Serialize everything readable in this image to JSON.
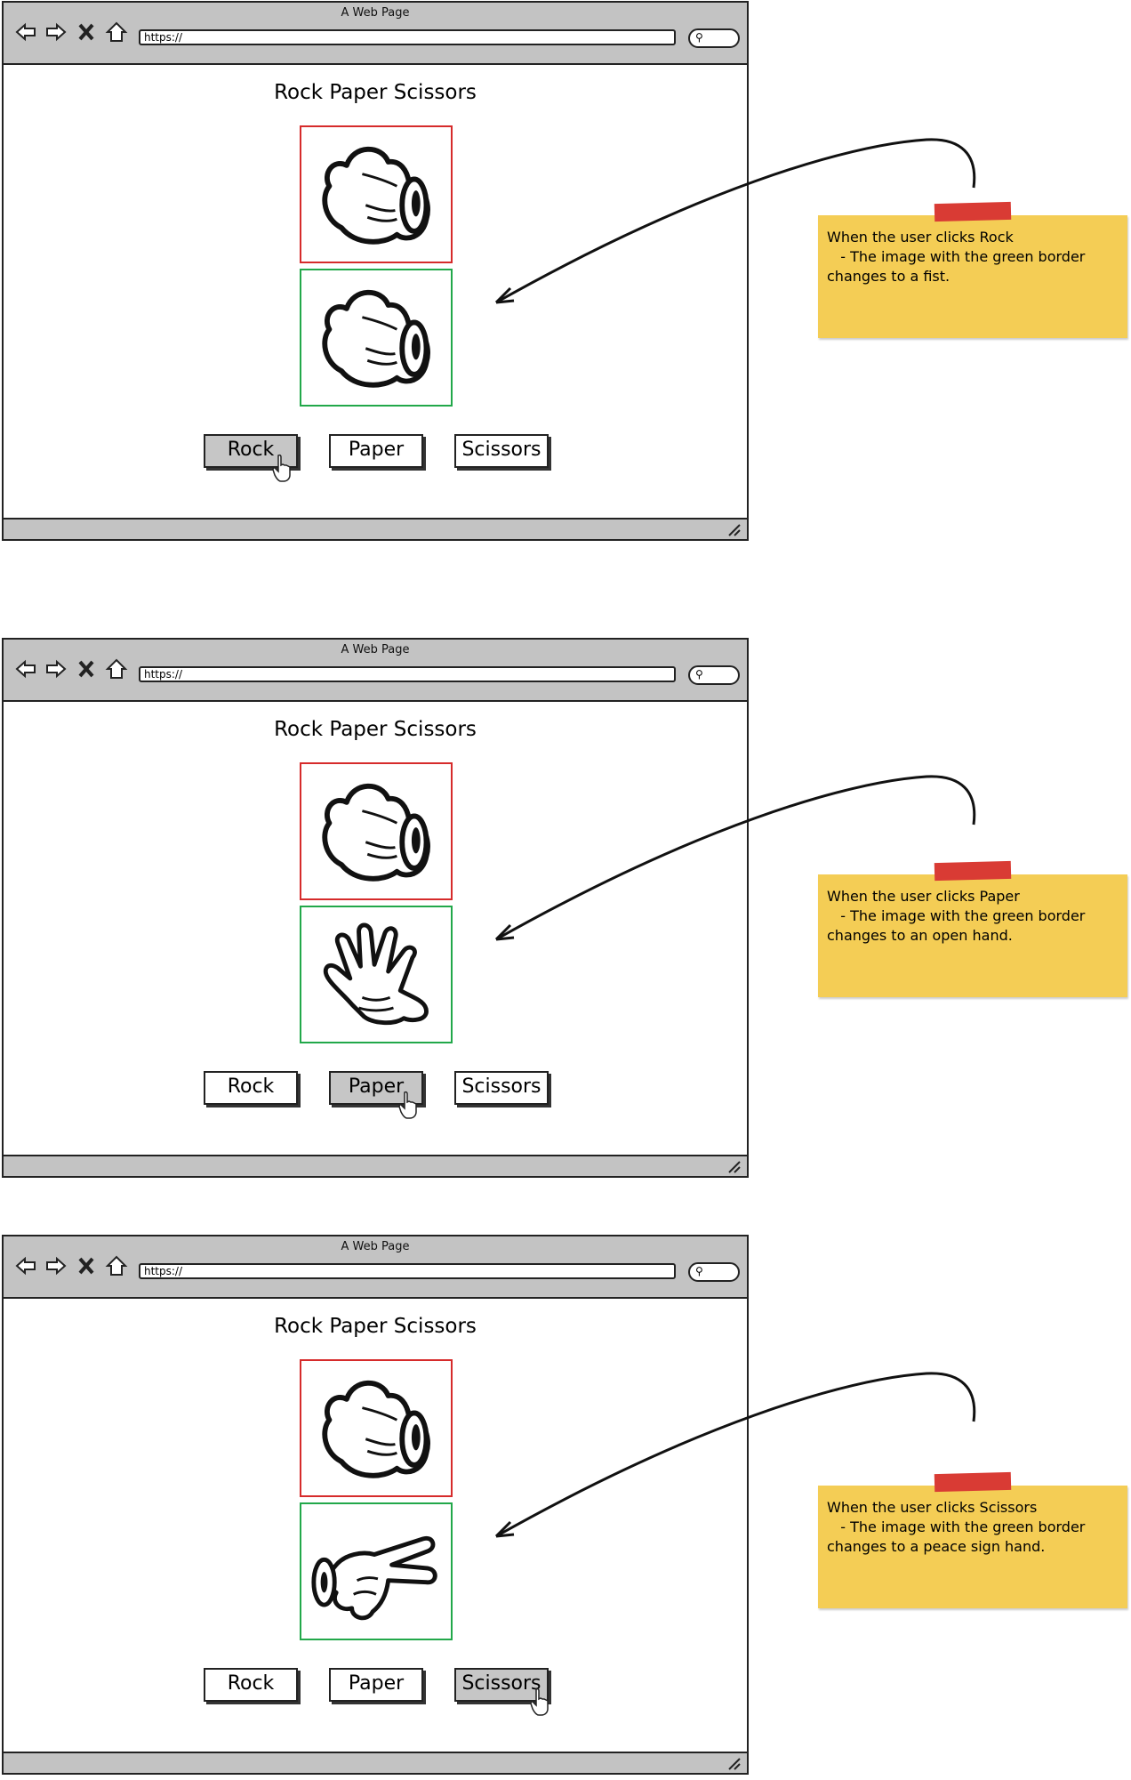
{
  "browser": {
    "window_title": "A Web Page",
    "url": "https://"
  },
  "frames": [
    {
      "page_title": "Rock Paper Scissors",
      "buttons": {
        "rock": "Rock",
        "paper": "Paper",
        "scissors": "Scissors"
      },
      "active_button": "rock",
      "green_image": "fist",
      "note": [
        "When the user clicks Rock",
        "   - The image with the green border",
        "changes to a fist."
      ]
    },
    {
      "page_title": "Rock Paper Scissors",
      "buttons": {
        "rock": "Rock",
        "paper": "Paper",
        "scissors": "Scissors"
      },
      "active_button": "paper",
      "green_image": "open-hand",
      "note": [
        "When the user clicks Paper",
        "   - The image with the green border",
        "changes to an open hand."
      ]
    },
    {
      "page_title": "Rock Paper Scissors",
      "buttons": {
        "rock": "Rock",
        "paper": "Paper",
        "scissors": "Scissors"
      },
      "active_button": "scissors",
      "green_image": "peace-sign-hand",
      "note": [
        "When the user clicks Scissors",
        "   - The image with the green border",
        "changes to a peace sign hand."
      ]
    }
  ],
  "colors": {
    "chrome_gray": "#c3c3c3",
    "red_border": "#d62b2b",
    "green_border": "#22a84a",
    "sticky_note": "#f4cd55",
    "tape": "#d93b34"
  }
}
